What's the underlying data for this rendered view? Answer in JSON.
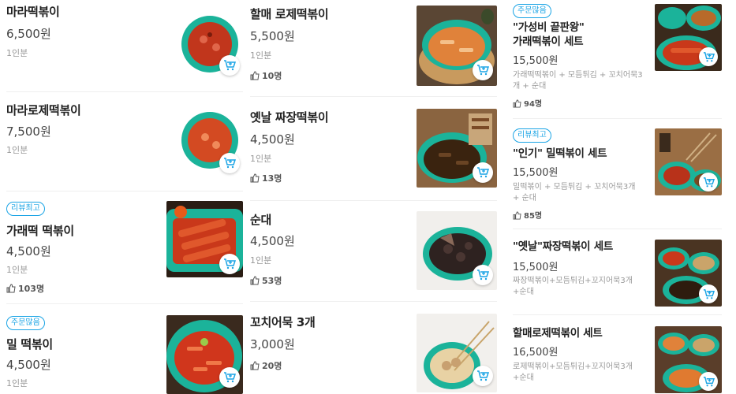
{
  "accent_color": "#1aa4e5",
  "icons": {
    "cart": "cart-plus-icon",
    "like": "thumbs-up-icon"
  },
  "columns": [
    {
      "items": [
        {
          "name": "마라떡볶이",
          "price": "6,500원",
          "serving": "1인분"
        },
        {
          "name": "마라로제떡볶이",
          "price": "7,500원",
          "serving": "1인분"
        },
        {
          "badge": "리뷰최고",
          "name": "가래떡 떡볶이",
          "price": "4,500원",
          "serving": "1인분",
          "likes": "103명"
        },
        {
          "badge": "주문많음",
          "name": "밀 떡볶이",
          "price": "4,500원",
          "serving": "1인분"
        }
      ]
    },
    {
      "items": [
        {
          "name": "할매 로제떡볶이",
          "price": "5,500원",
          "serving": "1인분",
          "likes": "10명"
        },
        {
          "name": "옛날 짜장떡볶이",
          "price": "4,500원",
          "serving": "1인분",
          "likes": "13명"
        },
        {
          "name": "순대",
          "price": "4,500원",
          "serving": "1인분",
          "likes": "53명"
        },
        {
          "name": "꼬치어묵 3개",
          "price": "3,000원",
          "likes": "20명"
        }
      ]
    },
    {
      "items": [
        {
          "badge": "주문많음",
          "name_line1": "\"가성비 끝판왕\"",
          "name_line2": "가래떡볶이 세트",
          "price": "15,500원",
          "desc_line1": "가래떡떡볶이 + 모듬튀김 + 꼬치어묵3",
          "desc_line2": "개 + 순대",
          "likes": "94명"
        },
        {
          "badge": "리뷰최고",
          "name": "\"인기\" 밀떡볶이 세트",
          "price": "15,500원",
          "desc_line1": "밀떡볶이 + 모듬튀김 + 꼬치어묵3개",
          "desc_line2": "+ 순대",
          "likes": "85명"
        },
        {
          "name": "\"옛날\"짜장떡볶이 세트",
          "price": "15,500원",
          "desc_line1": "짜장떡볶이+모듬튀김+꼬지어묵3개",
          "desc_line2": "+순대"
        },
        {
          "name": "할매로제떡볶이 세트",
          "price": "16,500원",
          "desc_line1": "로제떡볶이+모듬튀김+꼬지어묵3개",
          "desc_line2": "+순대"
        }
      ]
    }
  ]
}
